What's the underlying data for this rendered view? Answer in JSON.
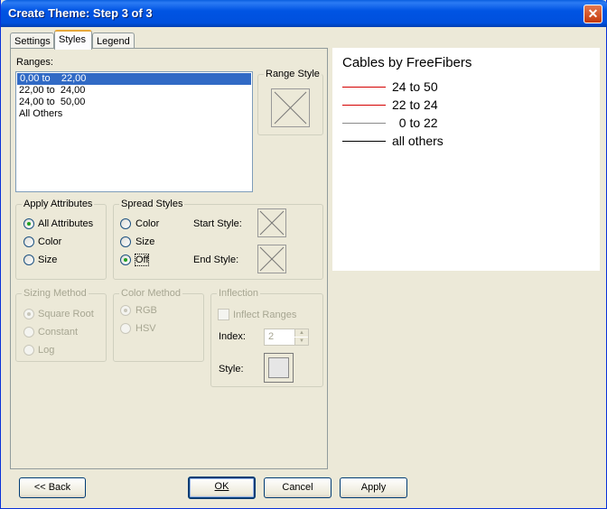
{
  "window": {
    "title": "Create Theme: Step 3 of 3",
    "close_glyph": "✕"
  },
  "tabs": [
    {
      "label": "Settings",
      "active": false
    },
    {
      "label": "Styles",
      "active": true
    },
    {
      "label": "Legend",
      "active": false
    }
  ],
  "ranges": {
    "label": "Ranges:",
    "items": [
      {
        "text": "0,00 to    22,00",
        "selected": true
      },
      {
        "text": "22,00 to  24,00",
        "selected": false
      },
      {
        "text": "24,00 to  50,00",
        "selected": false
      },
      {
        "text": "All Others",
        "selected": false
      }
    ]
  },
  "range_style": {
    "label": "Range Style"
  },
  "apply_attributes": {
    "label": "Apply Attributes",
    "options": [
      {
        "label": "All Attributes",
        "checked": true
      },
      {
        "label": "Color",
        "checked": false
      },
      {
        "label": "Size",
        "checked": false
      }
    ]
  },
  "spread_styles": {
    "label": "Spread Styles",
    "options": [
      {
        "label": "Color",
        "checked": false
      },
      {
        "label": "Size",
        "checked": false
      },
      {
        "label": "Off",
        "checked": true
      }
    ],
    "start_style_label": "Start Style:",
    "end_style_label": "End Style:"
  },
  "sizing_method": {
    "label": "Sizing Method",
    "options": [
      {
        "label": "Square Root",
        "checked": true
      },
      {
        "label": "Constant",
        "checked": false
      },
      {
        "label": "Log",
        "checked": false
      }
    ]
  },
  "color_method": {
    "label": "Color Method",
    "options": [
      {
        "label": "RGB",
        "checked": true
      },
      {
        "label": "HSV",
        "checked": false
      }
    ]
  },
  "inflection": {
    "label": "Inflection",
    "checkbox_label": "Inflect Ranges",
    "index_label": "Index:",
    "index_value": "2",
    "style_label": "Style:"
  },
  "buttons": {
    "back": "<< Back",
    "ok": "OK",
    "cancel": "Cancel",
    "apply": "Apply"
  },
  "preview": {
    "title": "Cables by FreeFibers",
    "legend": [
      {
        "text": "24 to 50",
        "color": "#d40000"
      },
      {
        "text": "22 to 24",
        "color": "#d40000"
      },
      {
        "text": "  0 to 22",
        "color": "#8a8a8a"
      },
      {
        "text": "all others",
        "color": "#000000"
      }
    ]
  },
  "colors": {
    "accent": "#316ac5",
    "title_bar": "#0054e3",
    "tab_highlight": "#e6a83c"
  }
}
